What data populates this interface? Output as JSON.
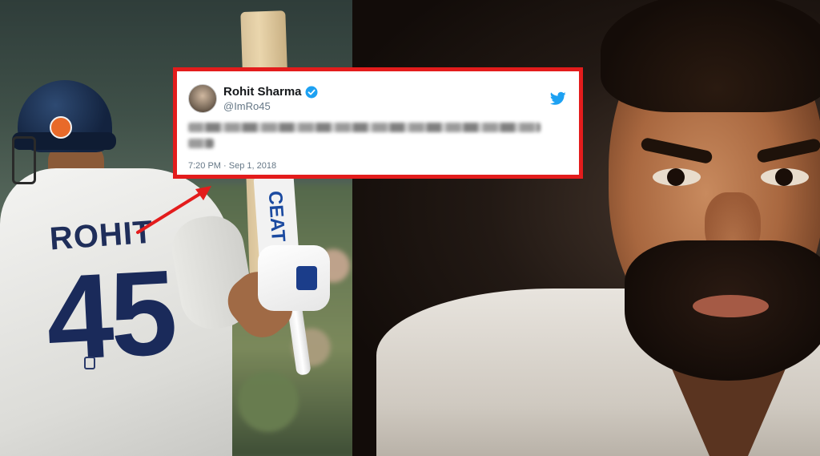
{
  "tweet": {
    "display_name": "Rohit Sharma",
    "handle": "@ImRo45",
    "timestamp": "7:20 PM · Sep 1, 2018",
    "verified": true,
    "platform_icon": "twitter-bird-icon",
    "body_blurred": true
  },
  "player_photo": {
    "jersey_name": "ROHIT",
    "jersey_number": "45",
    "bat_brand": "CEAT"
  },
  "colors": {
    "highlight_border": "#e31c1c",
    "twitter_blue": "#1da1f2",
    "jersey_navy": "#1a2a5a"
  }
}
